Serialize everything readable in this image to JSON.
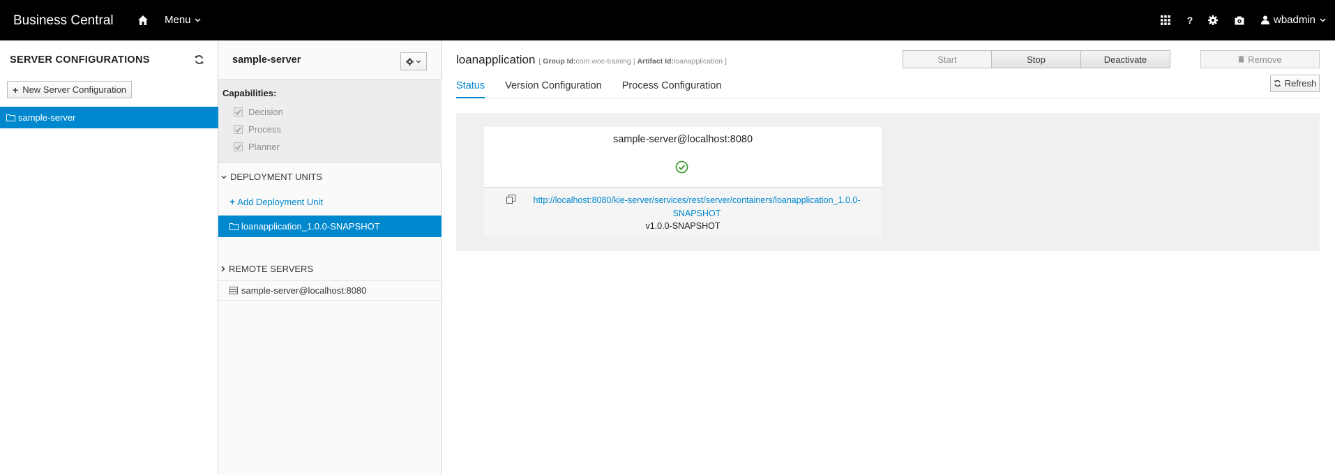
{
  "header": {
    "brand": "Business Central",
    "menu_label": "Menu",
    "user": "wbadmin",
    "icons": [
      "home-icon",
      "apps-grid-icon",
      "help-icon",
      "settings-icon",
      "camera-icon",
      "user-icon"
    ]
  },
  "server_configs": {
    "title": "SERVER CONFIGURATIONS",
    "new_button": "New Server Configuration",
    "items": [
      {
        "label": "sample-server",
        "selected": true
      }
    ]
  },
  "server_detail": {
    "title": "sample-server",
    "capabilities_label": "Capabilities:",
    "capabilities": [
      {
        "label": "Decision",
        "checked": true
      },
      {
        "label": "Process",
        "checked": true
      },
      {
        "label": "Planner",
        "checked": true
      }
    ],
    "deployment_units_label": "DEPLOYMENT UNITS",
    "add_unit_label": "Add Deployment Unit",
    "units": [
      {
        "label": "loanapplication_1.0.0-SNAPSHOT",
        "selected": true
      }
    ],
    "remote_servers_label": "REMOTE SERVERS",
    "remote_servers": [
      {
        "label": "sample-server@localhost:8080"
      }
    ]
  },
  "container": {
    "name": "loanapplication",
    "meta_open": "[",
    "group_label": "Group Id:",
    "group_id": "com.woc-training",
    "separator": "|",
    "artifact_label": "Artifact Id:",
    "artifact_id": "loanapplication",
    "meta_close": "]",
    "buttons": {
      "start": "Start",
      "stop": "Stop",
      "deactivate": "Deactivate",
      "remove": "Remove",
      "refresh": "Refresh"
    },
    "tabs": [
      {
        "label": "Status",
        "active": true
      },
      {
        "label": "Version Configuration",
        "active": false
      },
      {
        "label": "Process Configuration",
        "active": false
      }
    ],
    "status_card": {
      "host": "sample-server@localhost:8080",
      "status": "ok",
      "url_line1": "http://localhost:8080/kie-server/services/rest/server/containers/loanapplication_1.0.0-",
      "url_line2": "SNAPSHOT",
      "version": "v1.0.0-SNAPSHOT"
    }
  },
  "colors": {
    "accent": "#0088ce",
    "topbar": "#000000",
    "ok": "#3f9c35"
  }
}
